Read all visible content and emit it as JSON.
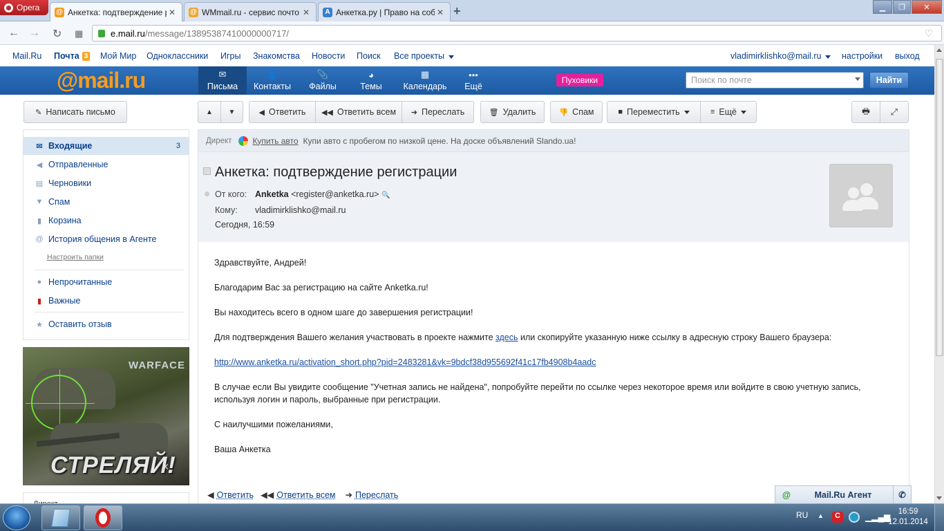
{
  "browser": {
    "menu_label": "Opera",
    "tabs": [
      {
        "title": "Анкетка: подтверждение р",
        "favicon": "mailru-icon"
      },
      {
        "title": "WMmail.ru - сервис почто",
        "favicon": "wmmail-icon"
      },
      {
        "title": "Анкетка.ру | Право на соб",
        "favicon": "anketka-icon"
      }
    ],
    "url_domain": "e.mail.ru",
    "url_path": "/message/13895387410000000717/"
  },
  "portal": {
    "links": [
      "Mail.Ru",
      "Почта",
      "Мой Мир",
      "Одноклассники",
      "Игры",
      "Знакомства",
      "Новости",
      "Поиск",
      "Все проекты"
    ],
    "mail_badge": "3",
    "user": "vladimirklishko@mail.ru",
    "settings": "настройки",
    "logout": "выход"
  },
  "header": {
    "logo_at": "@",
    "logo_text": "mail.ru",
    "nav": [
      "Письма",
      "Контакты",
      "Файлы",
      "Темы",
      "Календарь",
      "Ещё"
    ],
    "promo": "Пуховики",
    "search_placeholder": "Поиск по почте",
    "search_button": "Найти"
  },
  "toolbar": {
    "compose": "Написать письмо",
    "reply": "Ответить",
    "reply_all": "Ответить всем",
    "forward": "Переслать",
    "delete": "Удалить",
    "spam": "Спам",
    "move": "Переместить",
    "more": "Ещё"
  },
  "sidebar": {
    "folders": [
      {
        "label": "Входящие",
        "count": "3"
      },
      {
        "label": "Отправленные"
      },
      {
        "label": "Черновики"
      },
      {
        "label": "Спам"
      },
      {
        "label": "Корзина"
      },
      {
        "label": "История общения в Агенте"
      }
    ],
    "setup_folders": "Настроить папки",
    "filters": [
      "Непрочитанные",
      "Важные"
    ],
    "feedback": "Оставить отзыв",
    "ad_brand": "WARFACE",
    "ad_text": "СТРЕЛЯЙ!",
    "ad2_label": "Директ"
  },
  "direct_ad": {
    "label": "Директ",
    "link": "Купить авто",
    "text": "Купи авто с пробегом по низкой цене. На доске объявлений Slando.ua!"
  },
  "message": {
    "subject": "Анкетка: подтверждение регистрации",
    "from_label": "От кого:",
    "from_name": "Anketka",
    "from_email": "<register@anketka.ru>",
    "to_label": "Кому:",
    "to": "vladimirklishko@mail.ru",
    "date": "Сегодня, 16:59",
    "greeting": "Здравствуйте, Андрей!",
    "p1": "Благодарим Вас за регистрацию на сайте Anketka.ru!",
    "p2": "Вы находитесь всего в одном шаге до завершения регистрации!",
    "p3_before": "Для подтверждения Вашего желания участвовать в проекте нажмите ",
    "p3_link": "здесь",
    "p3_after": " или скопируйте указанную ниже ссылку в адресную строку Вашего браузера:",
    "activation_url": "http://www.anketka.ru/activation_short.php?pid=2483281&vk=9bdcf38d955692f41c17fb4908b4aadc",
    "p4": "В случае если Вы увидите сообщение \"Учетная запись не найдена\", попробуйте перейти по ссылке через некоторое время или войдите в свою учетную запись, используя логин и пароль, выбранные при регистрации.",
    "regards": "С наилучшими пожеланиями,",
    "signature": "Ваша Анкетка",
    "bottom_actions": [
      "Ответить",
      "Ответить всем",
      "Переслать"
    ]
  },
  "agent": {
    "title": "Mail.Ru Агент"
  },
  "taskbar": {
    "lang": "RU",
    "time": "16:59",
    "date": "12.01.2014"
  }
}
